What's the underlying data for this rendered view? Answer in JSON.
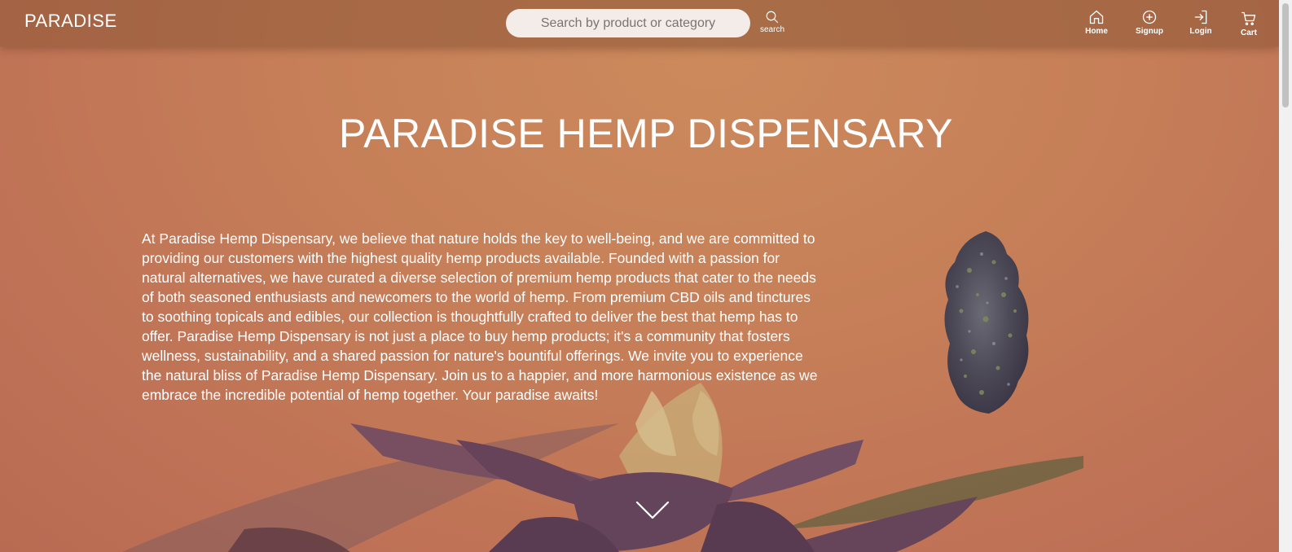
{
  "navbar": {
    "brand": "PARADISE",
    "search": {
      "placeholder": "Search by product or category",
      "value": "",
      "button_label": "search"
    },
    "items": [
      {
        "label": "Home",
        "icon": "home-icon"
      },
      {
        "label": "Signup",
        "icon": "plus-circle-icon"
      },
      {
        "label": "Login",
        "icon": "login-icon"
      },
      {
        "label": "Cart",
        "icon": "cart-icon"
      }
    ]
  },
  "hero": {
    "title": "PARADISE HEMP DISPENSARY",
    "description": "At Paradise Hemp Dispensary, we believe that nature holds the key to well-being, and we are committed to providing our customers with the highest quality hemp products available. Founded with a passion for natural alternatives, we have curated a diverse selection of premium hemp products that cater to the needs of both seasoned enthusiasts and newcomers to the world of hemp. From premium CBD oils and tinctures to soothing topicals and edibles, our collection is thoughtfully crafted to deliver the best that hemp has to offer. Paradise Hemp Dispensary is not just a place to buy hemp products; it's a community that fosters wellness, sustainability, and a shared passion for nature's bountiful offerings. We invite you to experience the natural bliss of Paradise Hemp Dispensary. Join us to a happier, and more harmonious existence as we embrace the incredible potential of hemp together. Your paradise awaits!",
    "scroll_icon": "chevron-down-icon"
  },
  "colors": {
    "background": "#c67f58",
    "navbar": "#a06a47",
    "search_field": "#f3ece8",
    "text": "#ffffff"
  }
}
